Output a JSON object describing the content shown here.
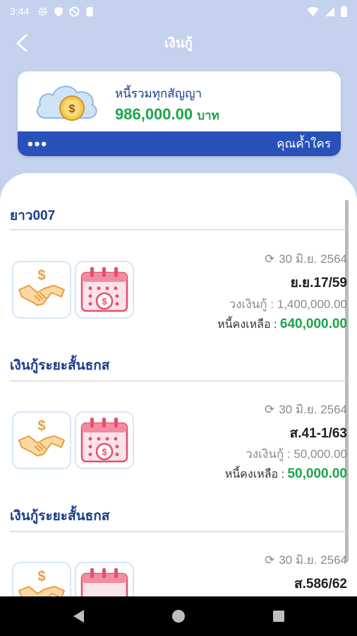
{
  "status_bar": {
    "time": "3:44"
  },
  "header": {
    "title": "เงินกู้"
  },
  "summary": {
    "label": "หนี้รวมทุกสัญญา",
    "amount": "986,000.00",
    "unit": "บาท",
    "more_label": "•••",
    "guarantor_link": "คุณค้ำใคร"
  },
  "sections": [
    {
      "title": "ยาว007",
      "loan": {
        "date": "30 มิ.ย. 2564",
        "contract": "ย.ย.17/59",
        "limit_label": "วงเงินกู้ :",
        "limit_value": "1,400,000.00",
        "remain_label": "หนี้คงเหลือ :",
        "remain_value": "640,000.00"
      }
    },
    {
      "title": "เงินกู้ระยะสั้นธกส",
      "loan": {
        "date": "30 มิ.ย. 2564",
        "contract": "ส.41-1/63",
        "limit_label": "วงเงินกู้ :",
        "limit_value": "50,000.00",
        "remain_label": "หนี้คงเหลือ :",
        "remain_value": "50,000.00"
      }
    },
    {
      "title": "เงินกู้ระยะสั้นธกส",
      "loan": {
        "date": "30 มิ.ย. 2564",
        "contract": "ส.586/62"
      }
    }
  ],
  "colors": {
    "primary_blue": "#2852ba",
    "heading_blue": "#1a3c8a",
    "money_green": "#1aa64a",
    "status_bg": "#c4d2ee"
  }
}
